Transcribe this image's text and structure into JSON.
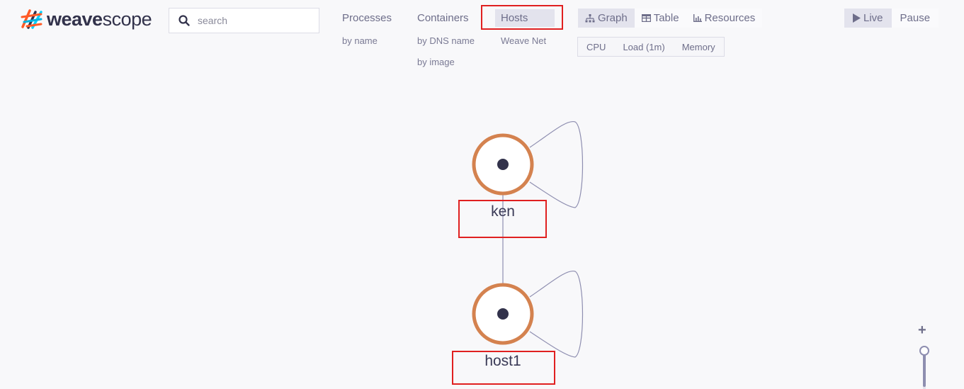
{
  "app": {
    "logo_bold": "weave",
    "logo_light": "scope",
    "logo_icon": "weave-logo-icon"
  },
  "search": {
    "placeholder": "search",
    "value": "",
    "icon": "search-icon"
  },
  "topologies": [
    {
      "label": "Processes",
      "sub": [
        "by name"
      ]
    },
    {
      "label": "Containers",
      "sub": [
        "by DNS name",
        "by image"
      ]
    },
    {
      "label": "Hosts",
      "sub": [
        "Weave Net"
      ],
      "active": true
    }
  ],
  "view_modes": [
    {
      "label": "Graph",
      "icon": "graph-icon",
      "active": true
    },
    {
      "label": "Table",
      "icon": "table-icon"
    },
    {
      "label": "Resources",
      "icon": "resources-icon"
    }
  ],
  "metrics": [
    "CPU",
    "Load (1m)",
    "Memory"
  ],
  "playback": {
    "live_label": "Live",
    "pause_label": "Pause",
    "live_icon": "play-icon"
  },
  "graph": {
    "nodes": [
      {
        "id": "ken",
        "label": "ken"
      },
      {
        "id": "host1",
        "label": "host1"
      }
    ],
    "edges": [
      {
        "from": "ken",
        "to": "host1"
      },
      {
        "from": "ken",
        "to": "ken"
      },
      {
        "from": "host1",
        "to": "host1"
      }
    ],
    "node_ring_color": "#d4824f",
    "node_center_color": "#32324b",
    "edge_color": "#8e8eb0"
  },
  "zoom_control": {
    "plus_label": "+",
    "level": 1.0
  },
  "annotations": {
    "highlight_color": "#e02020"
  }
}
